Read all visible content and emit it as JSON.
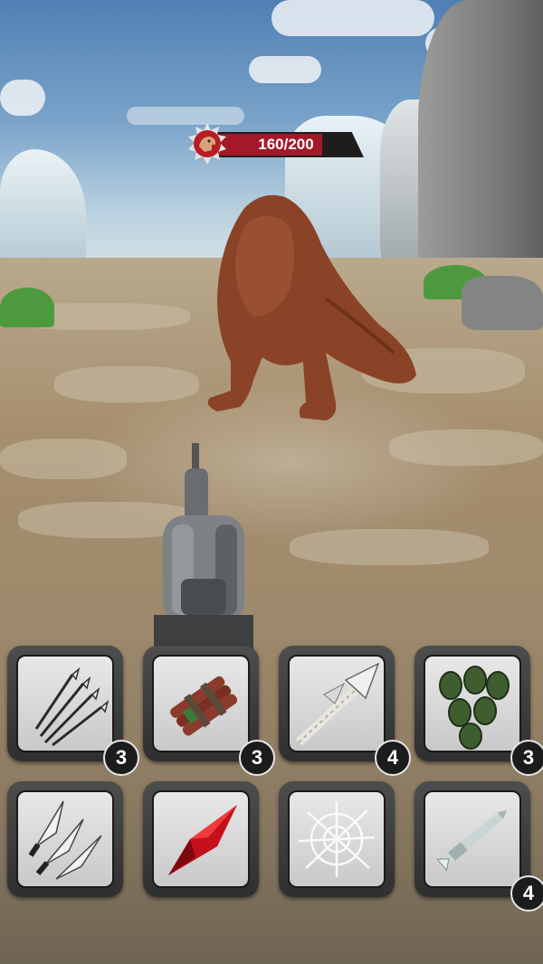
{
  "enemy": {
    "health_current": 160,
    "health_max": 200,
    "health_text": "160/200",
    "icon": "dinosaur-head-icon"
  },
  "colors": {
    "health_fill": "#a3192a",
    "slot_frame": "#3a3a3a",
    "slot_face": "#d8d8d8",
    "badge_bg": "#1c1c1c"
  },
  "inventory": {
    "slots": [
      {
        "name": "arrows",
        "icon": "arrows-icon",
        "count": "3"
      },
      {
        "name": "dynamite",
        "icon": "dynamite-icon",
        "count": "3"
      },
      {
        "name": "feathered-spear",
        "icon": "spear-icon",
        "count": "4"
      },
      {
        "name": "grenades",
        "icon": "grenades-icon",
        "count": "3"
      },
      {
        "name": "throwing-knives",
        "icon": "knives-icon",
        "count": ""
      },
      {
        "name": "red-crystal",
        "icon": "crystal-icon",
        "count": ""
      },
      {
        "name": "net",
        "icon": "net-icon",
        "count": ""
      },
      {
        "name": "dart",
        "icon": "dart-icon",
        "count": "4"
      }
    ]
  }
}
